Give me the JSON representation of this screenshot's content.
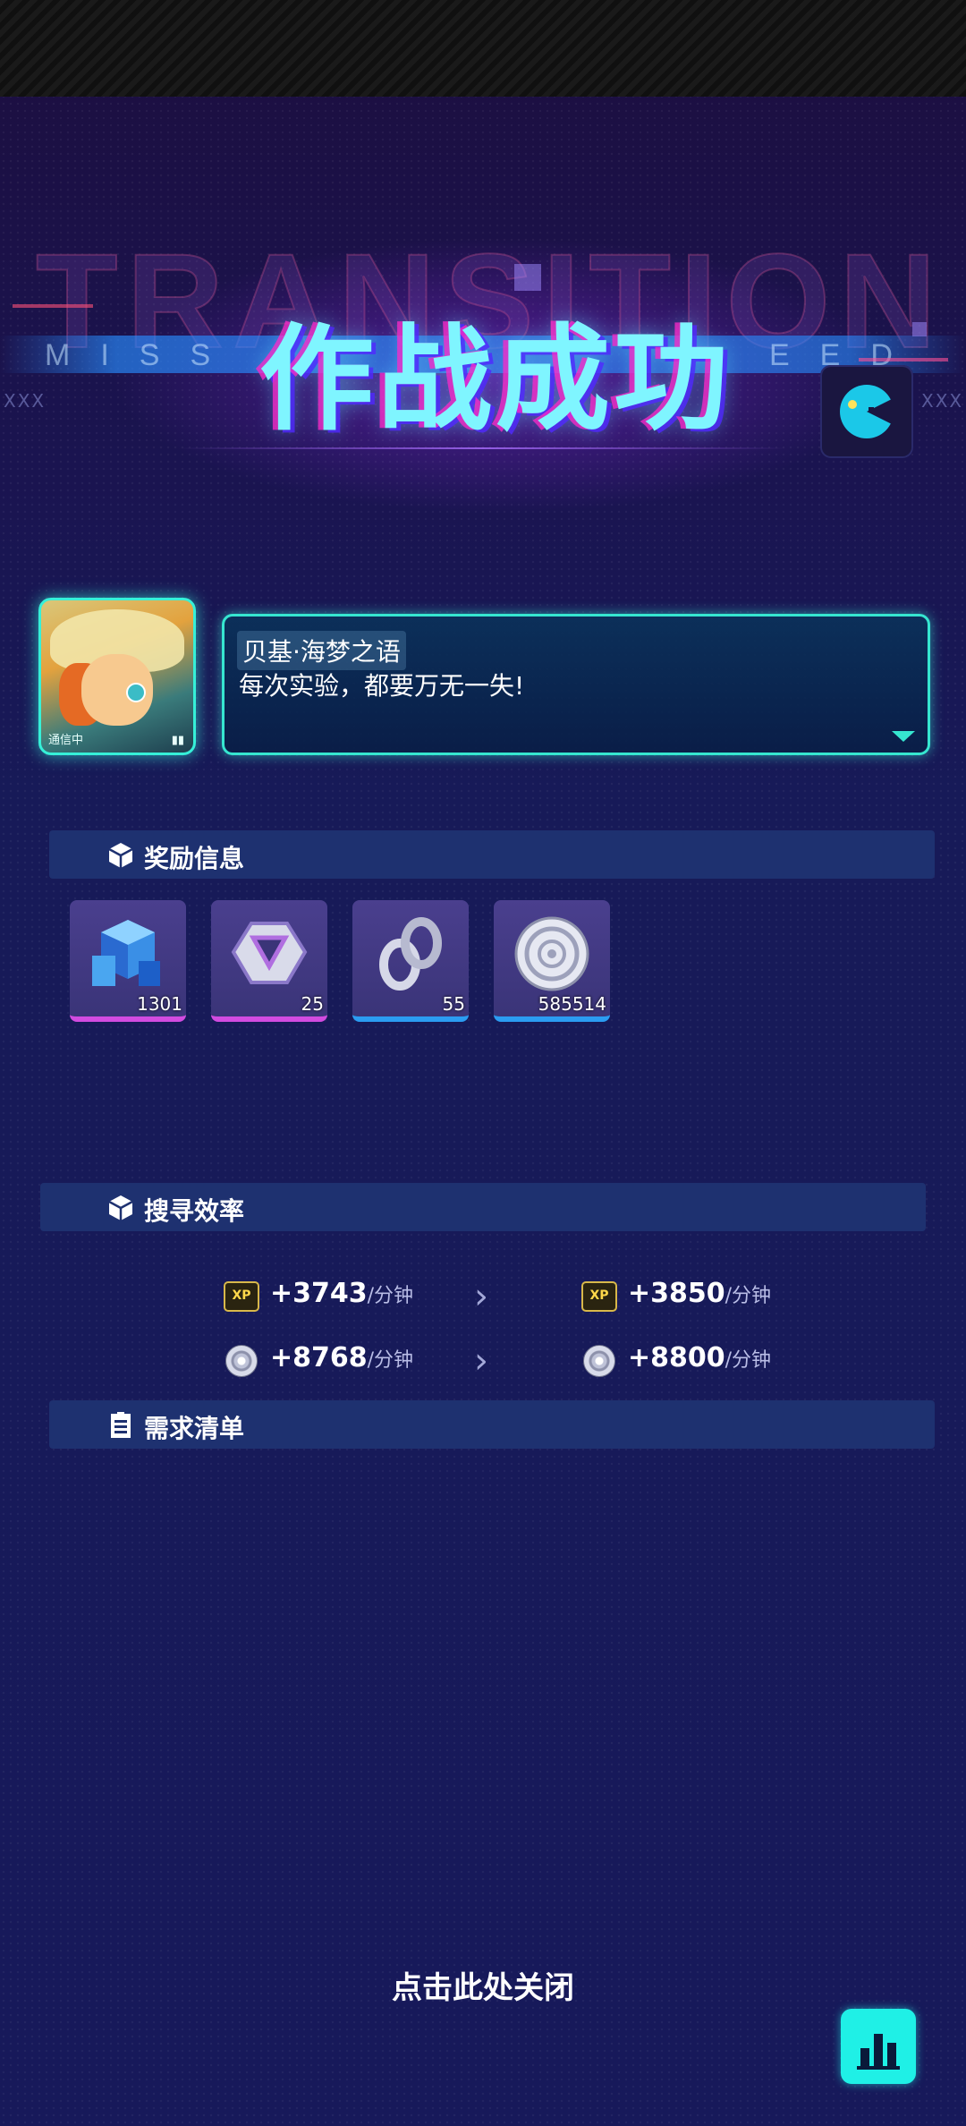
{
  "header": {
    "bg_word": "TRANSITION",
    "band_left": "MISS",
    "band_right": "EED",
    "xxx_left": "XXX",
    "xxx_right": "XXX",
    "title": "作战成功"
  },
  "speaker": {
    "portrait_tag": "通信中",
    "name": "贝基·海梦之语",
    "line": "每次实验，都要万无一失!"
  },
  "rewards": {
    "section_label": "奖励信息",
    "items": [
      {
        "icon": "blue-cubes-icon",
        "quantity": "1301",
        "rarity_color": "#d24be0"
      },
      {
        "icon": "silver-ring-frame-icon",
        "quantity": "25",
        "rarity_color": "#d24be0"
      },
      {
        "icon": "chain-link-icon",
        "quantity": "55",
        "rarity_color": "#2b9cf2"
      },
      {
        "icon": "silver-coin-icon",
        "quantity": "585514",
        "rarity_color": "#2b9cf2"
      }
    ]
  },
  "efficiency": {
    "section_label": "搜寻效率",
    "rows": [
      {
        "icon": "xp-icon",
        "xp_label": "XP",
        "before": "+3743",
        "after": "+3850",
        "unit": "/分钟"
      },
      {
        "icon": "coin-icon",
        "before": "+8768",
        "after": "+8800",
        "unit": "/分钟"
      }
    ]
  },
  "demand": {
    "section_label": "需求清单"
  },
  "footer": {
    "close_text": "点击此处关闭"
  },
  "colors": {
    "accent_cyan": "#36e6d0",
    "title_cyan": "#7ff5ff",
    "section_bg": "#1e3170"
  }
}
